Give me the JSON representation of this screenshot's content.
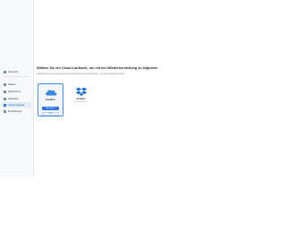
{
  "sidebar": {
    "items": [
      {
        "label": "Übersicht",
        "icon": "home-icon",
        "active": false
      },
      {
        "label": "Dateien",
        "icon": "folder-icon",
        "active": false
      },
      {
        "label": "Wiederherst.",
        "icon": "restore-icon",
        "active": false
      },
      {
        "label": "Aktivitäten",
        "icon": "activity-icon",
        "active": false
      },
      {
        "label": "Cloud-Laufwerk",
        "icon": "cloud-icon",
        "active": true
      },
      {
        "label": "Einstellungen",
        "icon": "gear-icon",
        "active": false
      }
    ]
  },
  "main": {
    "title": "Wählen Sie ein Cloud-Laufwerk, um mit der Wiederherstellung zu beginnen",
    "subtitle": "Verbinden Sie ein Cloud-Konto und durchsuchen Sie Ihre Dateien, um sie wiederherzustellen.",
    "providers": [
      {
        "name": "OneDrive",
        "status": "",
        "primary_button": "Anmelden",
        "secondary_button": "Lokal",
        "selected": true
      },
      {
        "name": "Dropbox",
        "status": "Nicht verbunden",
        "selected": false
      }
    ]
  },
  "colors": {
    "accent": "#2f73dc",
    "onedrive": "#3a86e0",
    "dropbox": "#1f6fd6"
  }
}
